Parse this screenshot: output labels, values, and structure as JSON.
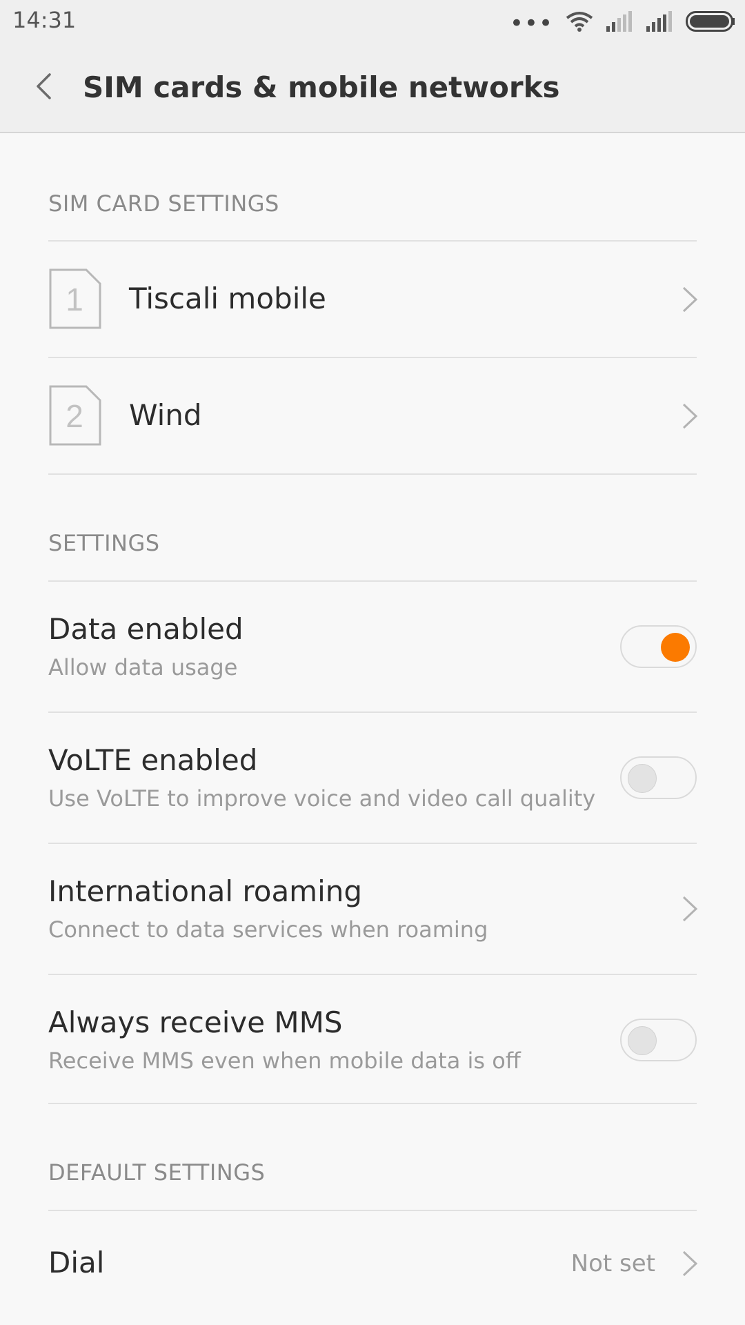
{
  "status_bar": {
    "time": "14:31",
    "dots": "•••"
  },
  "header": {
    "title": "SIM cards & mobile networks"
  },
  "sim_section": {
    "label": "SIM CARD SETTINGS",
    "sims": [
      {
        "number": "1",
        "name": "Tiscali mobile"
      },
      {
        "number": "2",
        "name": "Wind"
      }
    ]
  },
  "settings_section": {
    "label": "SETTINGS",
    "items": [
      {
        "title": "Data enabled",
        "subtitle": "Allow data usage",
        "toggle": "on"
      },
      {
        "title": "VoLTE enabled",
        "subtitle": "Use VoLTE to improve voice and video call quality",
        "toggle": "off"
      },
      {
        "title": "International roaming",
        "subtitle": "Connect to data services when roaming",
        "toggle": "none"
      },
      {
        "title": "Always receive MMS",
        "subtitle": "Receive MMS even when mobile data is off",
        "toggle": "off"
      }
    ]
  },
  "default_section": {
    "label": "DEFAULT SETTINGS",
    "items": [
      {
        "title": "Dial",
        "value": "Not set"
      }
    ]
  },
  "colors": {
    "accent": "#fb7a00",
    "header_bg": "#efefef",
    "page_bg": "#f8f8f8"
  },
  "icons": [
    "wifi-icon",
    "signal-icon",
    "battery-icon",
    "back-icon",
    "sim-card-icon",
    "chevron-right-icon"
  ]
}
